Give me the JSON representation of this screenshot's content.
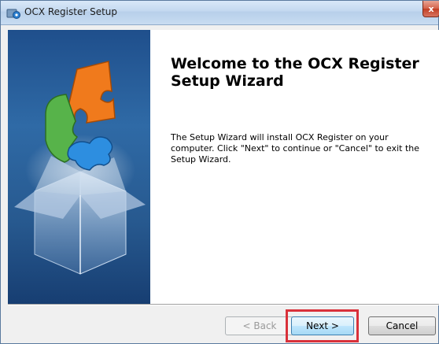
{
  "window": {
    "title": "OCX Register Setup",
    "close_glyph": "x"
  },
  "main": {
    "heading": "Welcome to the OCX Register Setup Wizard",
    "body": "The Setup Wizard will install OCX Register on your computer. Click \"Next\" to continue or \"Cancel\" to exit the Setup Wizard."
  },
  "buttons": {
    "back": "< Back",
    "next": "Next >",
    "cancel": "Cancel"
  },
  "colors": {
    "highlight": "#d9313a",
    "sidebar": "#2f6aa6"
  },
  "icons": {
    "app": "ocx-setup-icon",
    "sidebar_art": "puzzle-box-icon",
    "close": "close-icon"
  }
}
